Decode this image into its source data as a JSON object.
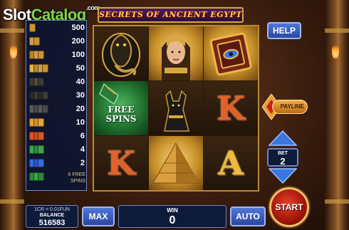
{
  "logo": {
    "slot": "Slot",
    "catalog": "Catalog",
    "com": ".com"
  },
  "game_title": "SECRETS OF ANCIENT EGYPT",
  "paytable": [
    {
      "symbol": "pharaoh-icon",
      "value": "500",
      "colors": [
        "#c9932e"
      ]
    },
    {
      "symbol": "queen-icon",
      "value": "200",
      "colors": [
        "#d0a050",
        "#c9932e"
      ]
    },
    {
      "symbol": "book-icon",
      "value": "100",
      "colors": [
        "#b8862a",
        "#d0a050",
        "#c9932e"
      ]
    },
    {
      "symbol": "pyramid-icon",
      "value": "50",
      "colors": [
        "#e2b440",
        "#b8862a",
        "#d0a050",
        "#c9932e"
      ]
    },
    {
      "symbol": "cobra-icon",
      "value": "40",
      "colors": [
        "#3a3a3a",
        "#5a4a2a",
        "#3a3a3a"
      ]
    },
    {
      "symbol": "anubis-icon",
      "value": "30",
      "colors": [
        "#2a2a2a",
        "#3a3a3a",
        "#2a2a2a",
        "#3a3a3a"
      ]
    },
    {
      "symbol": "scarab-icon",
      "value": "20",
      "colors": [
        "#5a5a5a",
        "#4a4a4a",
        "#5a5a5a",
        "#4a4a4a"
      ]
    },
    {
      "symbol": "letter-a-icon",
      "value": "10",
      "colors": [
        "#e2a43a",
        "#d0902a",
        "#e2a43a"
      ]
    },
    {
      "symbol": "letter-k-icon",
      "value": "6",
      "colors": [
        "#d8582a",
        "#c84a1a",
        "#d8582a"
      ]
    },
    {
      "symbol": "letter-q-icon",
      "value": "4",
      "colors": [
        "#3aa84a",
        "#2a8a3a",
        "#3aa84a"
      ]
    },
    {
      "symbol": "letter-j-icon",
      "value": "2",
      "colors": [
        "#3a6ad8",
        "#2a58c0",
        "#3a6ad8"
      ]
    },
    {
      "symbol": "free-spins-icon",
      "value": "6 FREE SPINS",
      "colors": [
        "#2a8a3a",
        "#3aa84a",
        "#2a8a3a"
      ]
    }
  ],
  "reels": [
    [
      {
        "type": "cobra",
        "bg": "dark"
      },
      {
        "type": "free-spins",
        "bg": "green",
        "text": "FREE SPINS"
      },
      {
        "type": "letter-k",
        "bg": "dark",
        "text": "K"
      }
    ],
    [
      {
        "type": "queen",
        "bg": "gold"
      },
      {
        "type": "anubis",
        "bg": "dark"
      },
      {
        "type": "pyramid",
        "bg": "gold"
      }
    ],
    [
      {
        "type": "book",
        "bg": "gold"
      },
      {
        "type": "letter-k",
        "bg": "dark",
        "text": "K"
      },
      {
        "type": "letter-a",
        "bg": "dark",
        "text": "A"
      }
    ]
  ],
  "controls": {
    "help_label": "HELP",
    "payline_label": "PAYLINE",
    "bet_label": "BET",
    "bet_value": "2",
    "start_label": "START",
    "max_label": "MAX",
    "auto_label": "AUTO"
  },
  "status": {
    "rate": "1CR = 0.01FUN",
    "balance_label": "BALANCE",
    "balance_value": "516583",
    "win_label": "WIN",
    "win_value": "0"
  },
  "colors": {
    "panel_bg": "#0e1a3a",
    "panel_border": "#6a88c8",
    "button_blue": "#2a46a0",
    "start_red": "#a01608",
    "gold": "#d8a83e"
  }
}
